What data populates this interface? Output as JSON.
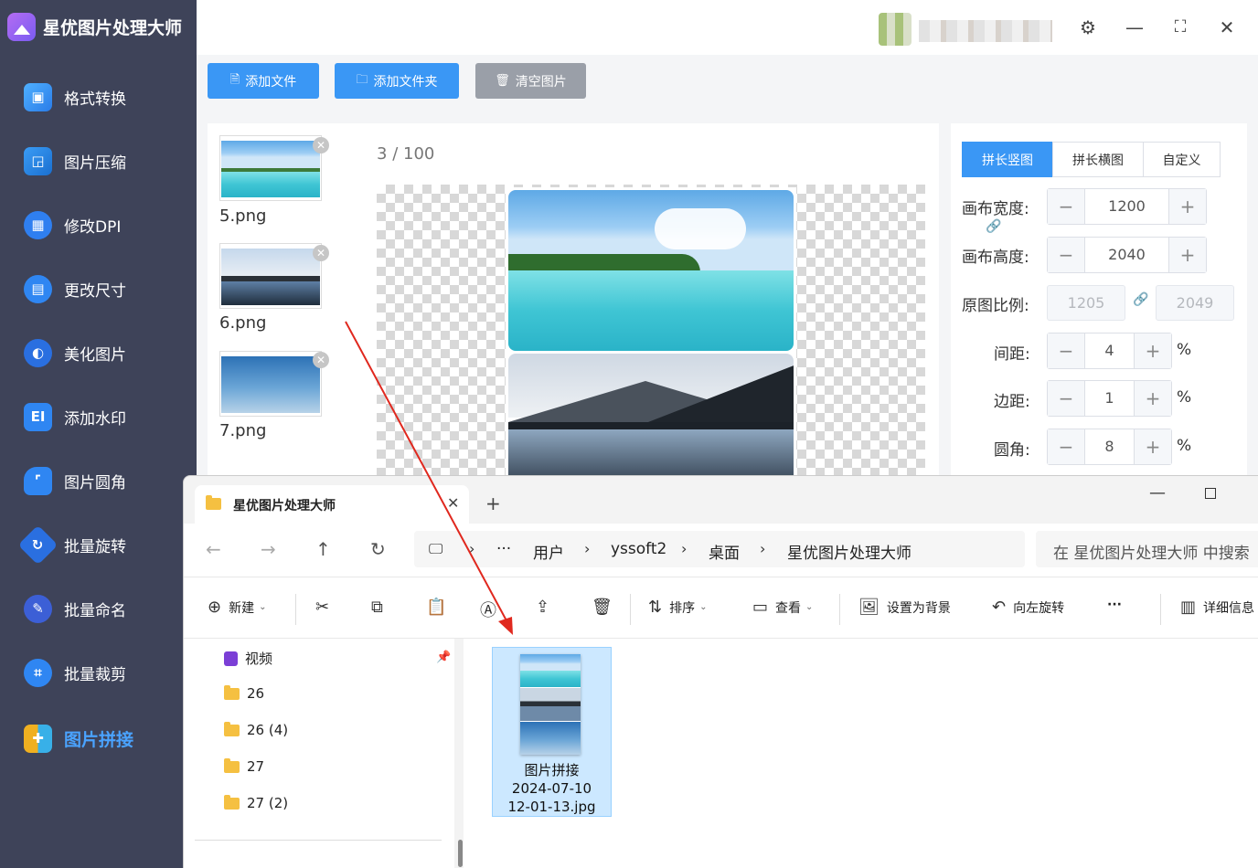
{
  "app": {
    "title": "星优图片处理大师",
    "colors": {
      "sidebar": "#3e4359",
      "accent": "#3a97f5",
      "active_nav": "#4aa3ff",
      "clear_button": "#9a9fa8"
    },
    "sidebar": {
      "items": [
        {
          "label": "格式转换",
          "icon": "format-convert-icon"
        },
        {
          "label": "图片压缩",
          "icon": "compress-icon"
        },
        {
          "label": "修改DPI",
          "icon": "dpi-icon"
        },
        {
          "label": "更改尺寸",
          "icon": "resize-icon"
        },
        {
          "label": "美化图片",
          "icon": "beautify-icon"
        },
        {
          "label": "添加水印",
          "icon": "watermark-icon"
        },
        {
          "label": "图片圆角",
          "icon": "round-corner-icon"
        },
        {
          "label": "批量旋转",
          "icon": "rotate-icon"
        },
        {
          "label": "批量命名",
          "icon": "rename-icon"
        },
        {
          "label": "批量裁剪",
          "icon": "crop-icon"
        },
        {
          "label": "图片拼接",
          "icon": "stitch-icon",
          "active": true
        }
      ]
    },
    "toolbar": {
      "add_file": "添加文件",
      "add_folder": "添加文件夹",
      "clear": "清空图片"
    },
    "files": [
      "5.png",
      "6.png",
      "7.png"
    ],
    "counter": {
      "current": "3",
      "sep": "/",
      "total": "100"
    },
    "settings": {
      "tabs": [
        "拼长竖图",
        "拼长横图",
        "自定义"
      ],
      "canvas_width_label": "画布宽度:",
      "canvas_width": "1200",
      "canvas_height_label": "画布高度:",
      "canvas_height": "2040",
      "ratio_label": "原图比例:",
      "ratio_w": "1205",
      "ratio_h": "2049",
      "spacing_label": "间距:",
      "spacing": "4",
      "margin_label": "边距:",
      "margin": "1",
      "radius_label": "圆角:",
      "radius": "8",
      "percent": "%"
    }
  },
  "explorer": {
    "tab_title": "星优图片处理大师",
    "breadcrumbs": [
      "用户",
      "yssoft2",
      "桌面",
      "星优图片处理大师"
    ],
    "ellipsis": "···",
    "search_placeholder": "在 星优图片处理大师 中搜索",
    "commands": {
      "new": "新建",
      "sort": "排序",
      "view": "查看",
      "set_background": "设置为背景",
      "rotate_left": "向左旋转",
      "details": "详细信息",
      "more": "···"
    },
    "tree": [
      "视频",
      "26",
      "26 (4)",
      "27",
      "27 (2)"
    ],
    "file": {
      "name_line1": "图片拼接",
      "name_line2": "2024-07-10",
      "name_line3": "12-01-13.jpg"
    }
  }
}
